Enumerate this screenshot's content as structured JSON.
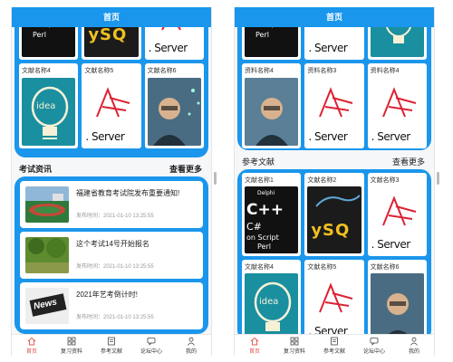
{
  "left": {
    "topbar_title": "首页",
    "top_grid_labels": [
      "文献名称4",
      "文献名称5",
      "文献名称6"
    ],
    "news_header": {
      "title": "考试资讯",
      "more": "查看更多"
    },
    "news": [
      {
        "title": "福建省教育考试院发布重要通知!",
        "time": "发布时间：2021-01-10 13:25:55"
      },
      {
        "title": "这个考试14号开始报名",
        "time": "发布时间：2021-01-10 13:25:55"
      },
      {
        "title": "2021年艺考倒计时!",
        "time": "发布时间：2021-01-10 13:25:55"
      }
    ]
  },
  "right": {
    "topbar_title": "首页",
    "top_grid_labels": [
      "资料名称4",
      "资料名称3",
      "资料名称4"
    ],
    "ref_header": {
      "title": "参考文献",
      "more": "查看更多"
    },
    "ref_grid_labels": [
      "文献名称1",
      "文献名称2",
      "文献名称3",
      "文献名称4",
      "文献名称5",
      "文献名称6"
    ]
  },
  "tabbar": [
    "首页",
    "复习资料",
    "参考文献",
    "论坛中心",
    "我的"
  ],
  "thumb_text": {
    "cpp": "C++",
    "delphi": "Delphi",
    "cs": "C#",
    "script": "on Script",
    "perl": "Perl",
    "ysq": "ySQ",
    "server": ". Server",
    "idea": "idea",
    "news": "News"
  },
  "colors": {
    "primary": "#1a96ec",
    "tab_active": "#e2534a",
    "background": "#f6f7f9"
  }
}
